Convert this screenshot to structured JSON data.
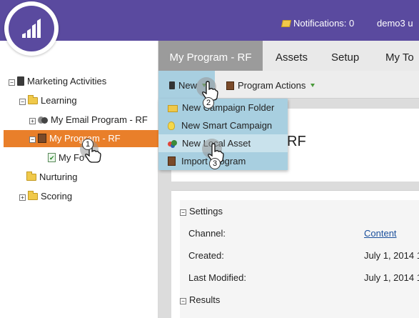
{
  "header": {
    "notifications_label": "Notifications: 0",
    "user_label": "demo3 u"
  },
  "tree": {
    "items": [
      {
        "label": "Marketing Activities",
        "expander": "−"
      },
      {
        "label": "Learning",
        "expander": "−"
      },
      {
        "label": "My Email Program - RF",
        "expander": "+"
      },
      {
        "label": "My Program - RF",
        "expander": "−"
      },
      {
        "label": "My Fo"
      },
      {
        "label": "Nurturing"
      },
      {
        "label": "Scoring",
        "expander": "+"
      }
    ]
  },
  "tabs": [
    {
      "label": "My Program - RF"
    },
    {
      "label": "Assets"
    },
    {
      "label": "Setup"
    },
    {
      "label": "My To"
    }
  ],
  "toolbar": {
    "new_label": "New",
    "program_actions_label": "Program Actions"
  },
  "menu": {
    "items": [
      {
        "label": "New Campaign Folder",
        "icon": "folder-icon"
      },
      {
        "label": "New Smart Campaign",
        "icon": "lightbulb-icon"
      },
      {
        "label": "New Local Asset",
        "icon": "local-asset-icon"
      },
      {
        "label": "Import Program",
        "icon": "import-program-icon"
      }
    ]
  },
  "content": {
    "title_fragment": "RF",
    "settings_header": "Settings",
    "settings_expander": "−",
    "fields": [
      {
        "label": "Channel:",
        "value": "Content"
      },
      {
        "label": "Created:",
        "value": "July 1, 2014 1"
      },
      {
        "label": "Last Modified:",
        "value": "July 1, 2014 1"
      }
    ],
    "results_header": "Results",
    "results_expander": "−"
  },
  "steps": [
    "1",
    "2",
    "3"
  ],
  "colors": {
    "header_bg": "#5a4a9f",
    "selected_row_bg": "#e97f2a",
    "menu_bg": "#a8cfe0",
    "menu_highlight": "#c9e2ec",
    "link": "#1a4f9c"
  }
}
